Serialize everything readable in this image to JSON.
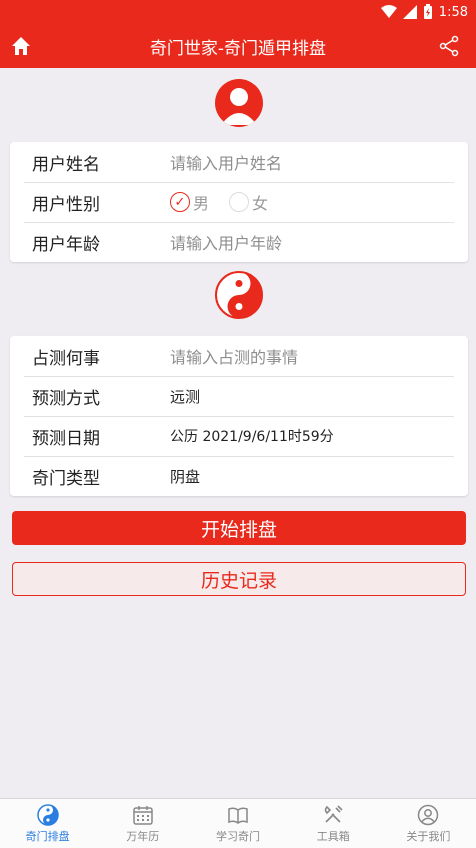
{
  "status": {
    "time": "1:58"
  },
  "header": {
    "title": "奇门世家-奇门遁甲排盘"
  },
  "user_card": {
    "name_label": "用户姓名",
    "name_placeholder": "请输入用户姓名",
    "gender_label": "用户性别",
    "gender_male": "男",
    "gender_female": "女",
    "gender_selected": "男",
    "age_label": "用户年龄",
    "age_placeholder": "请输入用户年龄"
  },
  "query_card": {
    "matter_label": "占测何事",
    "matter_placeholder": "请输入占测的事情",
    "method_label": "预测方式",
    "method_value": "远测",
    "date_label": "预测日期",
    "date_value": "公历 2021/9/6/11时59分",
    "type_label": "奇门类型",
    "type_value": "阴盘"
  },
  "actions": {
    "start_label": "开始排盘",
    "history_label": "历史记录"
  },
  "tabs": [
    {
      "label": "奇门排盘",
      "icon": "yinyang-icon",
      "active": true
    },
    {
      "label": "万年历",
      "icon": "calendar-icon",
      "active": false
    },
    {
      "label": "学习奇门",
      "icon": "book-icon",
      "active": false
    },
    {
      "label": "工具箱",
      "icon": "tools-icon",
      "active": false
    },
    {
      "label": "关于我们",
      "icon": "user-circle-icon",
      "active": false
    }
  ],
  "colors": {
    "primary": "#e8291c",
    "tab_active": "#2a7de1",
    "background": "#efedf2"
  }
}
